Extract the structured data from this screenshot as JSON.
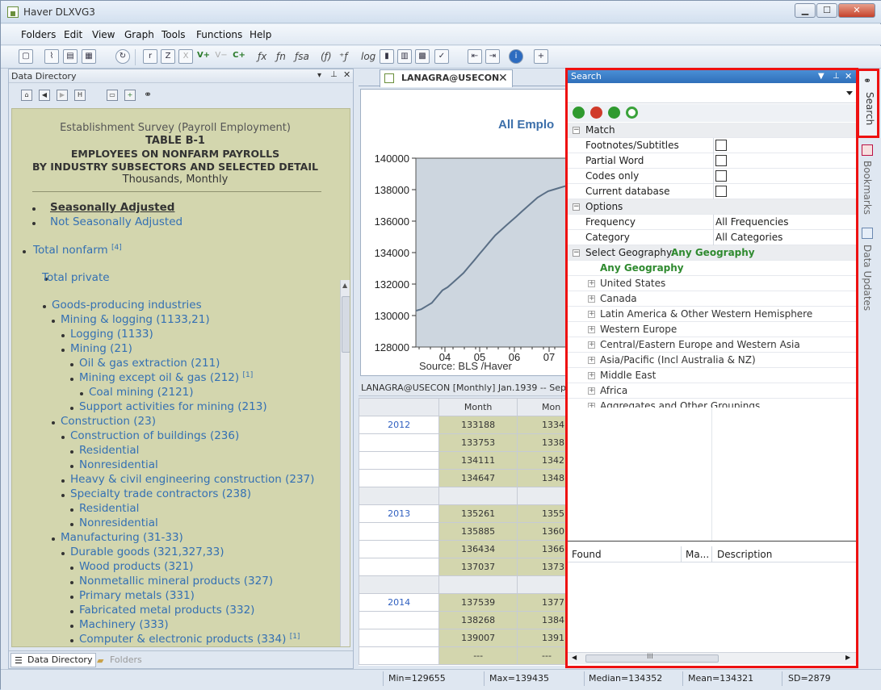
{
  "window": {
    "title": "Haver DLXVG3",
    "buttons": [
      "▁",
      "☐",
      "✕"
    ]
  },
  "menu": [
    "Folders",
    "Edit",
    "View",
    "Graph",
    "Tools",
    "Functions",
    "Help"
  ],
  "toolbar": {
    "texts": [
      "ƒx",
      "ƒn",
      "ƒsa",
      "(ƒ)",
      "⁺ƒ",
      "log"
    ]
  },
  "data_directory": {
    "panel_title": "Data Directory",
    "heading": {
      "survey": "Establishment Survey (Payroll Employment)",
      "table": "TABLE B-1",
      "line1": "EMPLOYEES ON NONFARM PAYROLLS",
      "line2": "BY INDUSTRY SUBSECTORS AND SELECTED DETAIL",
      "units": "Thousands, Monthly"
    },
    "adjust_options": [
      "Seasonally Adjusted",
      "Not Seasonally Adjusted"
    ],
    "items": [
      {
        "label": "Total nonfarm",
        "note": "[4]"
      },
      {
        "label": "Total private",
        "note": ""
      },
      {
        "label": "Goods-producing industries",
        "note": ""
      },
      {
        "label": "Mining & logging (1133,21)",
        "note": ""
      },
      {
        "label": "Logging (1133)",
        "note": ""
      },
      {
        "label": "Mining (21)",
        "note": ""
      },
      {
        "label": "Oil & gas extraction (211)",
        "note": ""
      },
      {
        "label": "Mining except oil & gas (212)",
        "note": "[1]"
      },
      {
        "label": "Coal mining (2121)",
        "note": ""
      },
      {
        "label": "Support activities for mining (213)",
        "note": ""
      },
      {
        "label": "Construction (23)",
        "note": ""
      },
      {
        "label": "Construction of buildings (236)",
        "note": ""
      },
      {
        "label": "Residential",
        "note": ""
      },
      {
        "label": "Nonresidential",
        "note": ""
      },
      {
        "label": "Heavy & civil engineering construction (237)",
        "note": ""
      },
      {
        "label": "Specialty trade contractors (238)",
        "note": ""
      },
      {
        "label": "Residential",
        "note": ""
      },
      {
        "label": "Nonresidential",
        "note": ""
      },
      {
        "label": "Manufacturing (31-33)",
        "note": ""
      },
      {
        "label": "Durable goods (321,327,33)",
        "note": ""
      },
      {
        "label": "Wood products (321)",
        "note": ""
      },
      {
        "label": "Nonmetallic mineral products (327)",
        "note": ""
      },
      {
        "label": "Primary metals (331)",
        "note": ""
      },
      {
        "label": "Fabricated metal products (332)",
        "note": ""
      },
      {
        "label": "Machinery (333)",
        "note": ""
      },
      {
        "label": "Computer & electronic products (334)",
        "note": "[1]"
      }
    ],
    "bottom_tabs": [
      "Data Directory",
      "Folders"
    ]
  },
  "document": {
    "tab_label": "LANAGRA@USECON",
    "info_bar": "LANAGRA@USECON    [Monthly]    Jan.1939 -- Sep",
    "chart_data": {
      "type": "line",
      "title": "All Emplo",
      "source": "Source:  BLS /Haver",
      "x": [
        "04",
        "05",
        "06",
        "07"
      ],
      "ylim": [
        128000,
        140000
      ],
      "yticks": [
        "140000",
        "138000",
        "136000",
        "134000",
        "132000",
        "130000",
        "128000"
      ],
      "series": [
        {
          "values": [
            130300,
            130400,
            130600,
            130800,
            131200,
            131600,
            131800,
            132100,
            132400,
            132700,
            133100,
            133500,
            133900,
            134300,
            134700,
            135100,
            135400,
            135700,
            136000,
            136300,
            136600,
            136900,
            137200,
            137500,
            137700,
            137900,
            138000,
            138100,
            138200,
            138300
          ]
        }
      ]
    },
    "table": {
      "col_header": [
        "",
        "Month",
        "Mon"
      ],
      "rows": [
        {
          "year": "2012",
          "v1": "133188",
          "v2": "1334"
        },
        {
          "year": "",
          "v1": "133753",
          "v2": "1338"
        },
        {
          "year": "",
          "v1": "134111",
          "v2": "1342"
        },
        {
          "year": "",
          "v1": "134647",
          "v2": "1348"
        },
        {
          "year": "",
          "v1": "",
          "v2": ""
        },
        {
          "year": "2013",
          "v1": "135261",
          "v2": "1355"
        },
        {
          "year": "",
          "v1": "135885",
          "v2": "1360"
        },
        {
          "year": "",
          "v1": "136434",
          "v2": "1366"
        },
        {
          "year": "",
          "v1": "137037",
          "v2": "1373"
        },
        {
          "year": "",
          "v1": "",
          "v2": ""
        },
        {
          "year": "2014",
          "v1": "137539",
          "v2": "1377"
        },
        {
          "year": "",
          "v1": "138268",
          "v2": "1384"
        },
        {
          "year": "",
          "v1": "139007",
          "v2": "1391"
        },
        {
          "year": "",
          "v1": "---",
          "v2": "---"
        }
      ]
    }
  },
  "search": {
    "title": "Search",
    "match": {
      "label": "Match",
      "fields": [
        "Footnotes/Subtitles",
        "Partial Word",
        "Codes only",
        "Current database"
      ]
    },
    "options": {
      "label": "Options",
      "frequency_label": "Frequency",
      "frequency_value": "All Frequencies",
      "category_label": "Category",
      "category_value": "All Categories"
    },
    "geography": {
      "label": "Select Geography:",
      "selected": "Any Geography",
      "any": "Any Geography",
      "regions": [
        "United States",
        "Canada",
        "Latin America & Other Western Hemisphere",
        "Western Europe",
        "Central/Eastern Europe and Western Asia",
        "Asia/Pacific (Incl Australia & NZ)",
        "Middle East",
        "Africa",
        "Aggregates and Other Groupings"
      ]
    },
    "results_columns": [
      "Found",
      "Ma...",
      "Description"
    ],
    "scroll_marker": "III"
  },
  "right_tabs": [
    "Search",
    "Bookmarks",
    "Data Updates"
  ],
  "status": {
    "min": "Min=129655",
    "max": "Max=139435",
    "median": "Median=134352",
    "mean": "Mean=134321",
    "sd": "SD=2879"
  },
  "colors": {
    "highlight": "#e11111",
    "link": "#3470b3",
    "panel_bg": "#d3d6ae",
    "geo_green": "#2f8a2f"
  }
}
